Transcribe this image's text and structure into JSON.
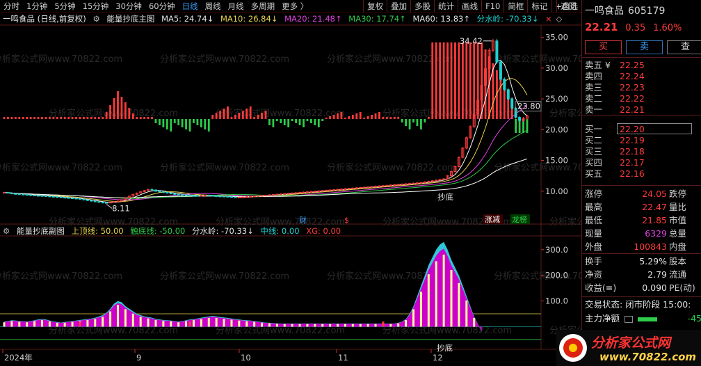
{
  "toolbar": {
    "items": [
      "分时",
      "1分钟",
      "5分钟",
      "15分钟",
      "30分钟",
      "60分钟",
      "日线",
      "周线",
      "月线",
      "多周期",
      "更多 〉"
    ],
    "right": [
      "复权",
      "叠加",
      "多股",
      "统计",
      "画线",
      "F10",
      "简框",
      "标记",
      "+自选",
      "返回"
    ]
  },
  "main_legend": {
    "title": "一鸣食品 (日线,前复权)",
    "indicator": "能量抄底主图",
    "ma5": "MA5: 24.74↓",
    "ma10": "MA10: 26.84↓",
    "ma20": "MA20: 21.48↑",
    "ma30": "MA30: 17.74↑",
    "ma60": "MA60: 13.83↑",
    "fsl": "分水岭: -70.33↓",
    "close_icon": "×",
    "diamond_icon": "◇"
  },
  "sub_legend": {
    "indicator": "能量抄底副图",
    "top": "上顶线: 50.00",
    "bottom": "触底线: -50.00",
    "fsl": "分水岭: -70.33↓",
    "mid": "中线: 0.00",
    "xg": "XG: 0.00"
  },
  "main_axis": {
    "ticks": [
      "35.00",
      "30.00",
      "25.00",
      "20.00",
      "15.00",
      "10.00"
    ]
  },
  "sub_axis": {
    "ticks": [
      "300.0",
      "200.0",
      "100.0"
    ]
  },
  "time_axis": {
    "labels": [
      "2024年",
      "9",
      "10",
      "11",
      "12"
    ]
  },
  "annotations": {
    "high": "34.42",
    "low": "8.11",
    "cur": "23.80",
    "chaodi1": "抄底",
    "chaodi2": "抄底",
    "cai": "财",
    "dollar": "$",
    "zhangjian": "涨减",
    "longbang": "龙榜"
  },
  "watermark": "分析家公式网www.70822.com",
  "panel": {
    "name": "一鸣食品",
    "code": "605179",
    "price": "22.21",
    "change": "0.35",
    "pct": "1.60%",
    "buy": "买",
    "sell": "卖",
    "check": "查",
    "asks": [
      {
        "label": "卖五 ¥",
        "price": "22.25"
      },
      {
        "label": "卖四",
        "price": "22.24"
      },
      {
        "label": "卖三",
        "price": "22.23"
      },
      {
        "label": "卖二",
        "price": "22.22"
      },
      {
        "label": "卖一",
        "price": "22.21"
      }
    ],
    "bids": [
      {
        "label": "买一",
        "price": "22.20"
      },
      {
        "label": "买二",
        "price": "22.19"
      },
      {
        "label": "买三",
        "price": "22.18"
      },
      {
        "label": "买四",
        "price": "22.17"
      },
      {
        "label": "买五",
        "price": "22.16"
      }
    ],
    "stats": [
      {
        "l": "涨停",
        "v": "24.05",
        "r": "跌停",
        "c": "red"
      },
      {
        "l": "最高",
        "v": "22.47",
        "r": "量比",
        "c": "red"
      },
      {
        "l": "最低",
        "v": "21.85",
        "r": "市值",
        "c": "red"
      },
      {
        "l": "现量",
        "v": "6329",
        "r": "总量",
        "c": "mag"
      },
      {
        "l": "外盘",
        "v": "100843",
        "r": "内盘",
        "c": "red"
      }
    ],
    "stats2": [
      {
        "l": "换手",
        "v": "5.29%",
        "r": "股本",
        "c": "white"
      },
      {
        "l": "净资",
        "v": "2.79",
        "r": "流通",
        "c": "white"
      },
      {
        "l": "收益(≡)",
        "v": "0.090",
        "r": "PE(动)",
        "c": "white"
      }
    ],
    "trade_status": "交易状态: 闭市阶段 15:00:",
    "net_flow_label": "主力净额",
    "net_flow_value": "-45"
  },
  "logo": {
    "text": "分析家公式网",
    "url": "www.70822.com"
  },
  "colors": {
    "up": "#ff3b3b",
    "down": "#1fd1d1",
    "ma5": "#ffffff",
    "ma10": "#e8d44a",
    "ma20": "#e040e0",
    "ma30": "#2ecc4a",
    "ma60": "#ffffff",
    "magenta": "#cc00cc",
    "yellowbar": "#ffff99",
    "cyanfill": "#30c8d8"
  },
  "chart_data": {
    "type": "line",
    "ylim": [
      5,
      37
    ],
    "closes": [
      9.8,
      9.7,
      9.6,
      9.55,
      9.5,
      9.45,
      9.4,
      9.35,
      9.3,
      9.28,
      9.25,
      9.2,
      9.15,
      9.1,
      9.05,
      9.0,
      8.95,
      8.9,
      8.85,
      8.8,
      8.7,
      8.6,
      8.5,
      8.4,
      8.3,
      8.2,
      8.15,
      8.11,
      8.2,
      8.3,
      8.4,
      8.6,
      8.9,
      9.2,
      9.5,
      9.7,
      9.9,
      10.1,
      10.3,
      10.2,
      10.0,
      9.9,
      9.8,
      9.7,
      9.6,
      9.5,
      9.45,
      9.4,
      9.35,
      9.3,
      9.28,
      9.25,
      9.3,
      9.35,
      9.3,
      9.25,
      9.2,
      9.18,
      9.15,
      9.1,
      9.05,
      9.0,
      9.02,
      9.05,
      9.1,
      9.15,
      9.2,
      9.25,
      9.3,
      9.35,
      9.4,
      9.45,
      9.5,
      9.55,
      9.6,
      9.65,
      9.7,
      9.75,
      9.8,
      9.85,
      9.9,
      9.95,
      10.0,
      10.05,
      10.1,
      10.15,
      10.2,
      10.25,
      10.3,
      10.35,
      10.4,
      10.45,
      10.5,
      10.55,
      10.6,
      10.65,
      10.7,
      10.75,
      10.8,
      10.85,
      10.9,
      10.95,
      11.0,
      11.05,
      11.1,
      11.15,
      11.2,
      11.25,
      11.3,
      11.35,
      11.4,
      11.5,
      11.6,
      11.7,
      11.8,
      11.9,
      12.0,
      12.5,
      13.2,
      14.0,
      15.5,
      17.0,
      18.7,
      20.5,
      22.5,
      24.8,
      27.2,
      29.9,
      32.9,
      34.42,
      31.0,
      28.2,
      26.5,
      25.0,
      23.5,
      22.0,
      21.5,
      21.86,
      22.21
    ],
    "energy": [
      20,
      22,
      25,
      24,
      22,
      21,
      20,
      22,
      25,
      28,
      30,
      28,
      24,
      20,
      18,
      16,
      18,
      20,
      22,
      24,
      26,
      28,
      30,
      32,
      35,
      40,
      45,
      55,
      70,
      90,
      100,
      95,
      80,
      70,
      60,
      50,
      45,
      40,
      38,
      35,
      30,
      28,
      26,
      25,
      24,
      22,
      20,
      22,
      25,
      28,
      30,
      32,
      35,
      38,
      40,
      42,
      40,
      38,
      36,
      34,
      32,
      30,
      28,
      26,
      25,
      24,
      22,
      20,
      18,
      16,
      15,
      14,
      13,
      12,
      12,
      12,
      12,
      12,
      12,
      12,
      12,
      12,
      12,
      12,
      12,
      12,
      12,
      12,
      12,
      12,
      12,
      12,
      12,
      12,
      12,
      12,
      12,
      12,
      12,
      12,
      12,
      12,
      12,
      12,
      15,
      20,
      30,
      50,
      80,
      120,
      160,
      200,
      240,
      270,
      300,
      320,
      330,
      300,
      260,
      230,
      200,
      160,
      120,
      80,
      40,
      10,
      -20
    ]
  }
}
